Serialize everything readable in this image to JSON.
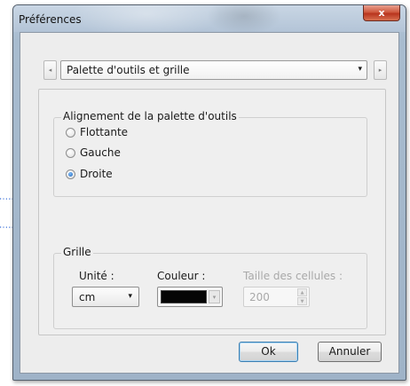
{
  "window": {
    "title": "Préférences",
    "close_label": "x"
  },
  "nav": {
    "prev_glyph": "◂",
    "next_glyph": "▸"
  },
  "page_select": {
    "value": "Palette d'outils et grille",
    "arrow": "▾"
  },
  "alignment": {
    "legend": "Alignement de la palette d'outils",
    "options": [
      {
        "label": "Flottante",
        "checked": false
      },
      {
        "label": "Gauche",
        "checked": false
      },
      {
        "label": "Droite",
        "checked": true
      }
    ]
  },
  "grid": {
    "legend": "Grille",
    "unit_label": "Unité :",
    "unit_value": "cm",
    "unit_arrow": "▾",
    "color_label": "Couleur :",
    "color_value": "#050505",
    "color_arrow": "▾",
    "cell_size_label": "Taille des cellules :",
    "cell_size_value": "200",
    "cell_size_disabled": true
  },
  "buttons": {
    "ok": "Ok",
    "cancel": "Annuler"
  },
  "colors": {
    "annotation_arrow": "#3a6fd8"
  },
  "icons": {
    "close": "close-icon",
    "chevron_left": "chevron-left-icon",
    "chevron_right": "chevron-right-icon",
    "dropdown": "chevron-down-icon",
    "spin_up": "spin-up-icon",
    "spin_down": "spin-down-icon"
  }
}
